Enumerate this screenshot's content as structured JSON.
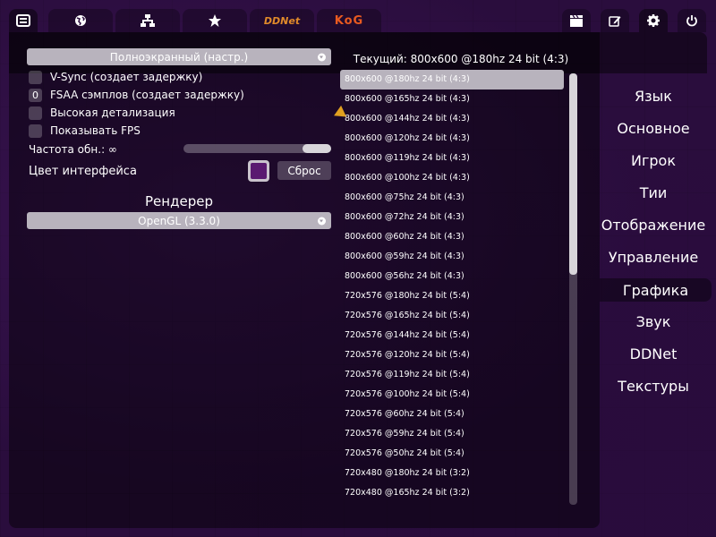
{
  "top_tabs": [
    {
      "icon": "newspaper-icon"
    },
    {
      "icon": "globe-icon"
    },
    {
      "icon": "network-icon"
    },
    {
      "icon": "star-icon"
    },
    {
      "label": "DDNet"
    },
    {
      "label": "KoG"
    }
  ],
  "right_tabs": [
    {
      "icon": "clapperboard-icon"
    },
    {
      "icon": "edit-icon"
    },
    {
      "icon": "gear-icon"
    },
    {
      "icon": "power-icon"
    }
  ],
  "display": {
    "mode": "Полноэкранный (настр.)",
    "vsync": "V-Sync (создает задержку)",
    "fsaa_value": "0",
    "fsaa": "FSAA сэмплов (создает задержку)",
    "high_detail": "Высокая детализация",
    "show_fps": "Показывать FPS",
    "refresh": "Частота обн.: ∞",
    "ui_color": "Цвет интерфейса",
    "reset": "Сброс",
    "renderer_title": "Рендерер",
    "renderer": "OpenGL (3.3.0)"
  },
  "resolutions": {
    "current": "Текущий: 800x600 @180hz 24 bit (4:3)",
    "items": [
      "800x600 @180hz 24 bit (4:3)",
      "800x600 @165hz 24 bit (4:3)",
      "800x600 @144hz 24 bit (4:3)",
      "800x600 @120hz 24 bit (4:3)",
      "800x600 @119hz 24 bit (4:3)",
      "800x600 @100hz 24 bit (4:3)",
      "800x600 @75hz 24 bit (4:3)",
      "800x600 @72hz 24 bit (4:3)",
      "800x600 @60hz 24 bit (4:3)",
      "800x600 @59hz 24 bit (4:3)",
      "800x600 @56hz 24 bit (4:3)",
      "720x576 @180hz 24 bit (5:4)",
      "720x576 @165hz 24 bit (5:4)",
      "720x576 @144hz 24 bit (5:4)",
      "720x576 @120hz 24 bit (5:4)",
      "720x576 @119hz 24 bit (5:4)",
      "720x576 @100hz 24 bit (5:4)",
      "720x576 @60hz 24 bit (5:4)",
      "720x576 @59hz 24 bit (5:4)",
      "720x576 @50hz 24 bit (5:4)",
      "720x480 @180hz 24 bit (3:2)",
      "720x480 @165hz 24 bit (3:2)"
    ]
  },
  "settings_nav": [
    "Язык",
    "Основное",
    "Игрок",
    "Тии",
    "Отображение",
    "Управление",
    "Графика",
    "Звук",
    "DDNet",
    "Текстуры"
  ],
  "colors": {
    "accent": "#5a1a70",
    "selected_row": "#b8b3bd",
    "background": "#2a0d3d"
  }
}
